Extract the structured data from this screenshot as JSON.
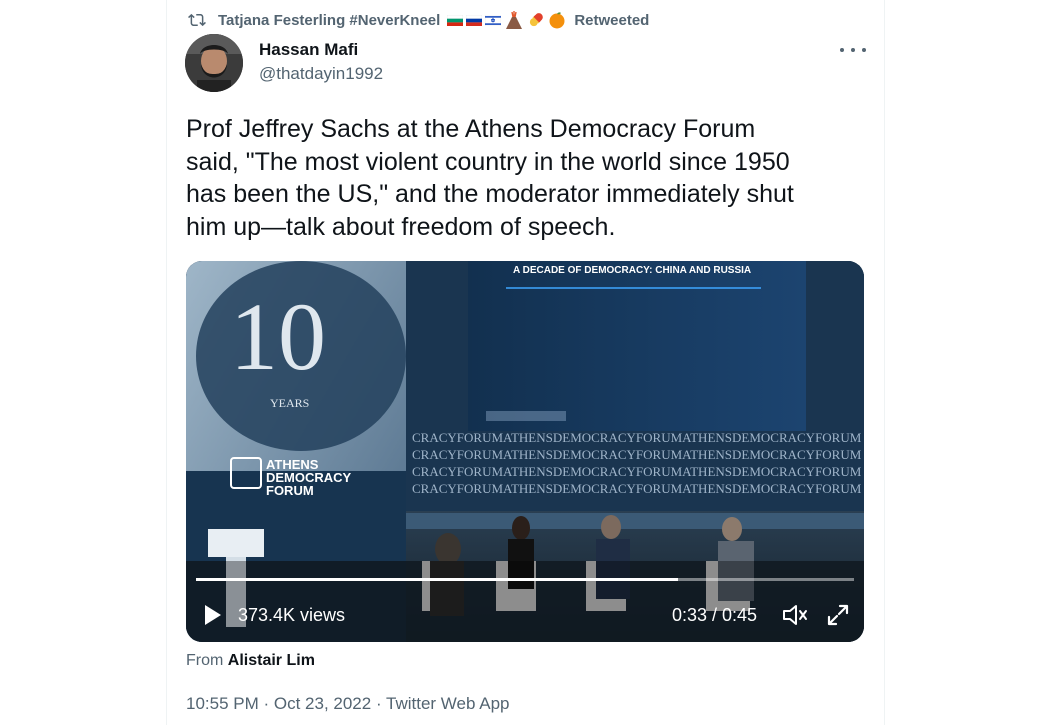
{
  "retweet": {
    "user": "Tatjana Festerling #NeverKneel",
    "label": "Retweeted"
  },
  "author": {
    "name": "Hassan Mafi",
    "handle": "@thatdayin1992"
  },
  "tweet": {
    "line1": "Prof Jeffrey Sachs at the Athens Democracy Forum",
    "line2": "said, \"The most violent country in the world since 1950",
    "line3": "has been the US,\" and the moderator immediately shut",
    "line4": "him up—talk about freedom of speech."
  },
  "video": {
    "views": "373.4K views",
    "time": "0:33 / 0:45",
    "progress": 0.733,
    "screen_title": "A DECADE OF DEMOCRACY: CHINA AND RUSSIA",
    "forum_lines": [
      "ATHENS",
      "DEMOCRACY",
      "FORUM"
    ],
    "years_number": "10",
    "years_label": "YEARS",
    "backdrop_text": "CRACYFORUMATHENSDEMOCRACYFORUMATHENSDEMOCRACYFORUM"
  },
  "source": {
    "prefix": "From",
    "name": "Alistair Lim"
  },
  "meta": "10:55 PM · Oct 23, 2022 · Twitter Web App",
  "colors": {
    "text": "#0f1419",
    "secondary": "#536471",
    "border": "#eff3f4"
  }
}
